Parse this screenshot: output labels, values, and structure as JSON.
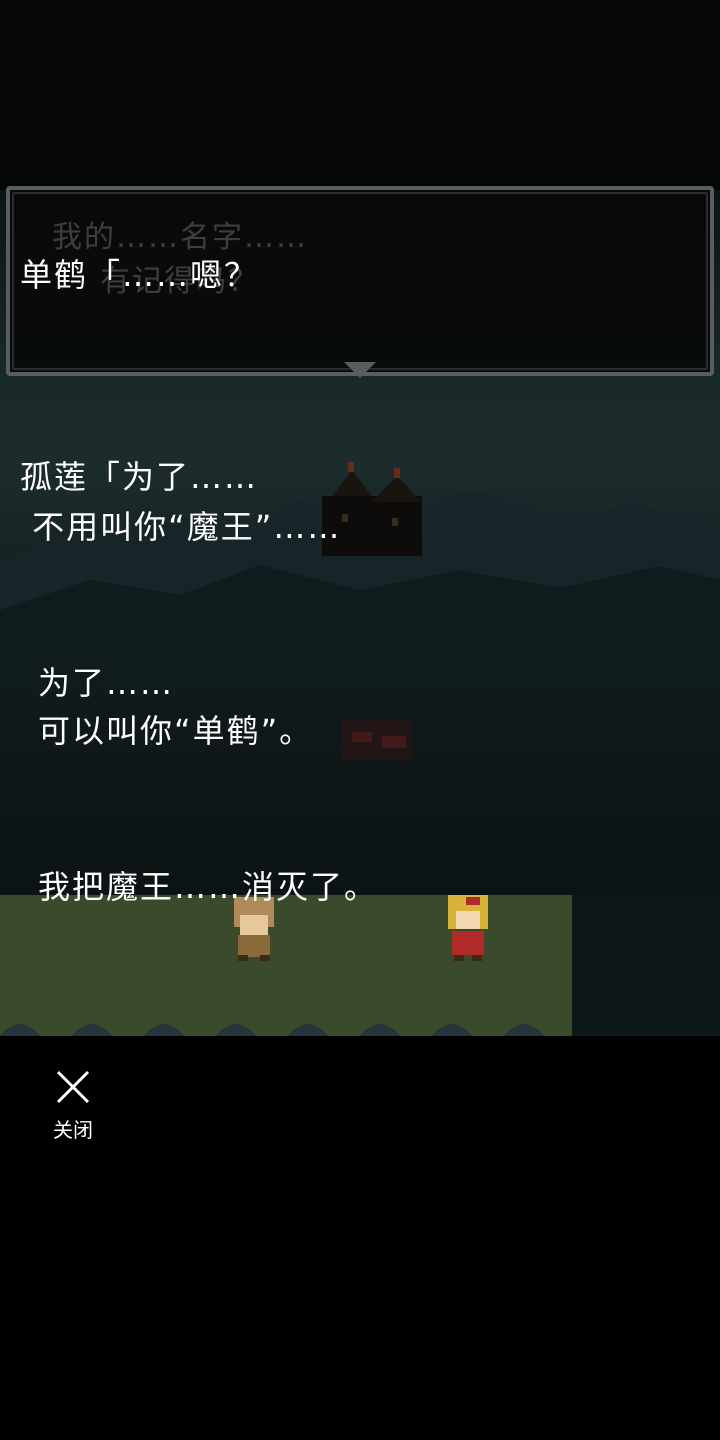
{
  "dialog": {
    "previous_line_1": "我的……名字……",
    "previous_line_2": "有记得吗？",
    "current_line": "单鹤「……嗯？"
  },
  "log": {
    "line_1": "孤莲「为了……",
    "line_2": " 不用叫你“魔王”……",
    "line_3": "为了……",
    "line_4": "可以叫你“单鹤”。",
    "line_5": "我把魔王……消灭了。"
  },
  "controls": {
    "close_label": "关闭",
    "close_icon": "close-icon"
  },
  "colors": {
    "text": "#ffffff",
    "ghost_text": "#3c3e40",
    "box_border": "#5a5d5e",
    "background": "#000000"
  }
}
